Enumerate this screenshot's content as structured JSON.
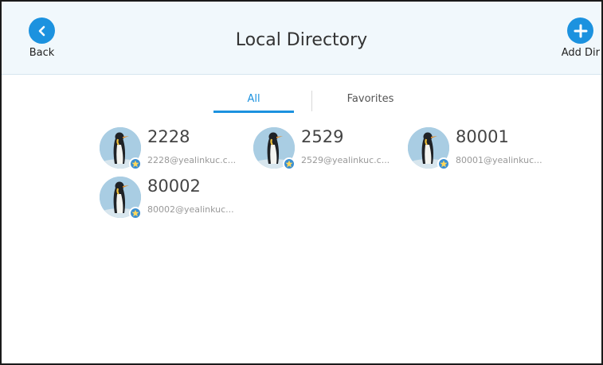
{
  "header": {
    "title": "Local Directory",
    "back_label": "Back",
    "add_label": "Add Dir"
  },
  "tabs": [
    {
      "label": "All",
      "active": true
    },
    {
      "label": "Favorites",
      "active": false
    }
  ],
  "contacts": [
    {
      "name": "2228",
      "email": "2228@yealinkuc.c...",
      "avatar": "penguin",
      "badge": "star-icon"
    },
    {
      "name": "2529",
      "email": "2529@yealinkuc.c...",
      "avatar": "penguin",
      "badge": "star-icon"
    },
    {
      "name": "80001",
      "email": "80001@yealinkuc...",
      "avatar": "penguin",
      "badge": "star-icon"
    },
    {
      "name": "80002",
      "email": "80002@yealinkuc...",
      "avatar": "penguin",
      "badge": "star-icon"
    }
  ],
  "colors": {
    "accent": "#1c92df",
    "header_bg": "#f1f8fc",
    "badge": "#3b8fd1"
  }
}
